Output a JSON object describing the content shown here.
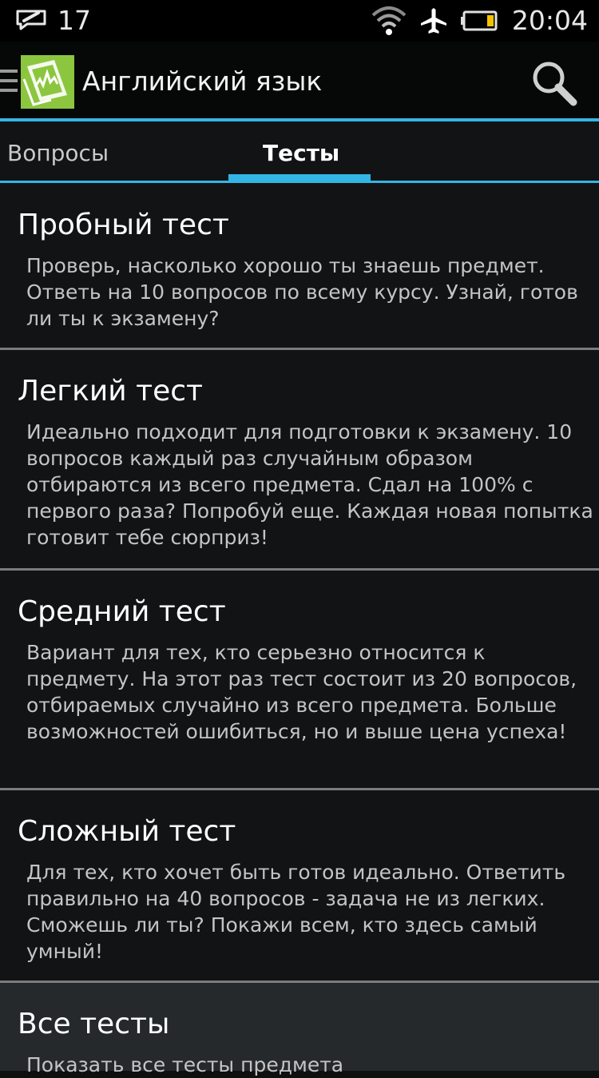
{
  "status_bar": {
    "notification_count": "17",
    "time": "20:04",
    "icons": [
      "message-icon",
      "wifi-icon",
      "airplane-mode-icon",
      "battery-icon"
    ]
  },
  "action_bar": {
    "title": "Английский язык",
    "icons": [
      "menu-icon",
      "app-logo-icon",
      "search-icon"
    ]
  },
  "tabs": [
    {
      "label": "Вопросы",
      "selected": false
    },
    {
      "label": "Тесты",
      "selected": true
    }
  ],
  "tests": [
    {
      "title": "Пробный тест",
      "description": "Проверь, насколько хорошо ты знаешь предмет. Ответь на 10 вопросов по всему курсу. Узнай, готов ли ты к экзамену?"
    },
    {
      "title": "Легкий тест",
      "description": "Идеально подходит для подготовки к экзамену. 10 вопросов каждый раз случайным образом отбираются из всего предмета. Сдал на 100% с первого раза? Попробуй еще. Каждая новая попытка готовит тебе сюрприз!"
    },
    {
      "title": "Средний тест",
      "description": "Вариант для тех, кто серьезно относится к предмету. На этот раз тест состоит из 20 вопросов, отбираемых случайно из всего предмета. Больше возможностей ошибиться, но и выше цена успеха!"
    },
    {
      "title": "Сложный тест",
      "description": "Для тех, кто хочет быть готов идеально. Ответить правильно на 40 вопросов - задача не из легких. Сможешь ли ты? Покажи всем, кто здесь самый умный!"
    },
    {
      "title": "Все тесты",
      "description": "Показать все тесты предмета"
    }
  ],
  "colors": {
    "accent": "#33b5e5",
    "background": "#111314",
    "action_bar": "#060707",
    "logo_green": "#8cc63f",
    "battery_level": "#f2c200"
  }
}
